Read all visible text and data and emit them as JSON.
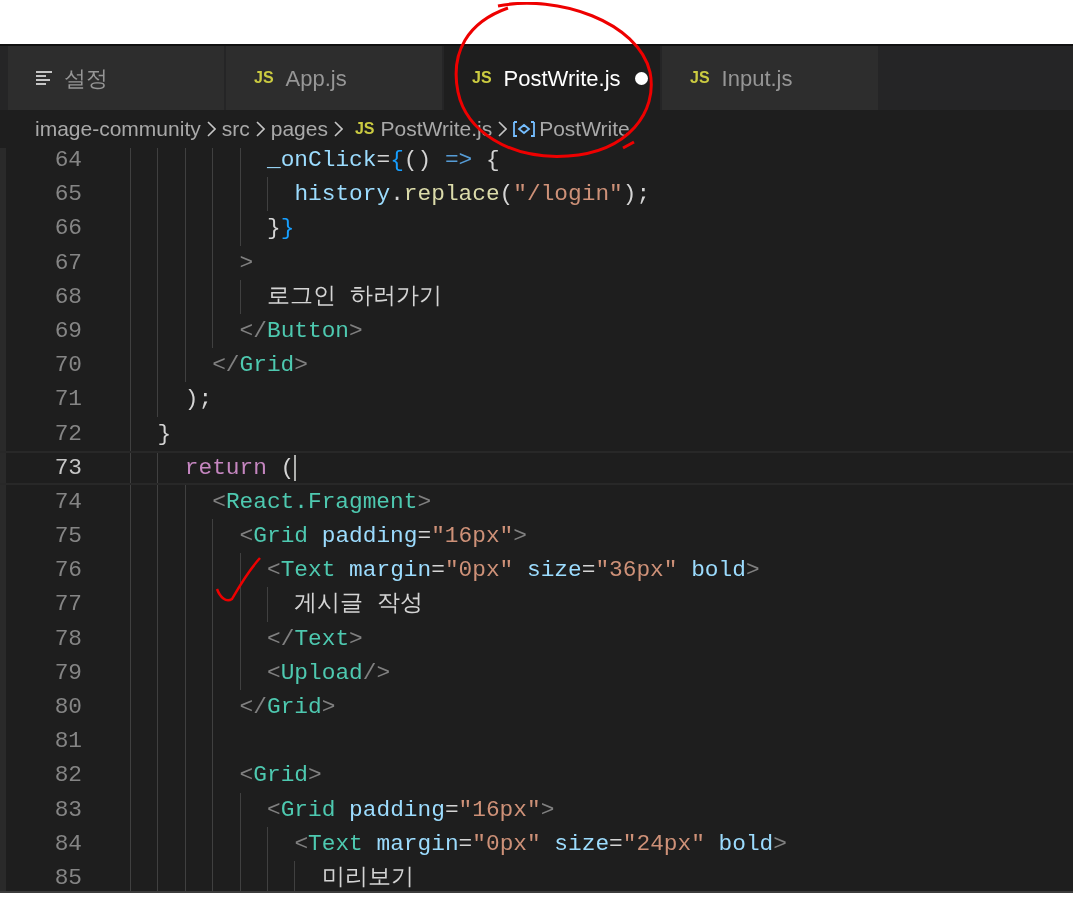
{
  "tabs": [
    {
      "kind": "settings",
      "label": "설정",
      "selected": false,
      "dirty": false
    },
    {
      "kind": "file",
      "icon_text": "JS",
      "label": "App.js",
      "selected": false,
      "dirty": false
    },
    {
      "kind": "file",
      "icon_text": "JS",
      "label": "PostWrite.js",
      "selected": true,
      "dirty": true
    },
    {
      "kind": "file",
      "icon_text": "JS",
      "label": "Input.js",
      "selected": false,
      "dirty": false
    }
  ],
  "breadcrumb": [
    {
      "kind": "folder",
      "label": "image-community"
    },
    {
      "kind": "folder",
      "label": "src"
    },
    {
      "kind": "folder",
      "label": "pages"
    },
    {
      "kind": "file",
      "icon_text": "JS",
      "label": "PostWrite.js"
    },
    {
      "kind": "symbol",
      "label": "PostWrite"
    }
  ],
  "lines": [
    {
      "number": "64",
      "current": false,
      "tokens": [
        {
          "text": "          _onClick",
          "kind": "attr"
        },
        {
          "text": "=",
          "kind": "plain"
        },
        {
          "text": "{",
          "kind": "bracket"
        },
        {
          "text": "() ",
          "kind": "plain"
        },
        {
          "text": "=>",
          "kind": "keyword"
        },
        {
          "text": " {",
          "kind": "plain"
        }
      ]
    },
    {
      "number": "65",
      "current": false,
      "tokens": [
        {
          "text": "            history",
          "kind": "var"
        },
        {
          "text": ".",
          "kind": "plain"
        },
        {
          "text": "replace",
          "kind": "fn"
        },
        {
          "text": "(",
          "kind": "plain"
        },
        {
          "text": "\"/login\"",
          "kind": "string"
        },
        {
          "text": ");",
          "kind": "plain"
        }
      ]
    },
    {
      "number": "66",
      "current": false,
      "tokens": [
        {
          "text": "          }",
          "kind": "plain"
        },
        {
          "text": "}",
          "kind": "bracket"
        }
      ]
    },
    {
      "number": "67",
      "current": false,
      "tokens": [
        {
          "text": "        >",
          "kind": "punct"
        }
      ]
    },
    {
      "number": "68",
      "current": false,
      "tokens": [
        {
          "text": "          로그인 하러가기",
          "kind": "plain"
        }
      ]
    },
    {
      "number": "69",
      "current": false,
      "tokens": [
        {
          "text": "        </",
          "kind": "punct"
        },
        {
          "text": "Button",
          "kind": "tag"
        },
        {
          "text": ">",
          "kind": "punct"
        }
      ]
    },
    {
      "number": "70",
      "current": false,
      "tokens": [
        {
          "text": "      </",
          "kind": "punct"
        },
        {
          "text": "Grid",
          "kind": "tag"
        },
        {
          "text": ">",
          "kind": "punct"
        }
      ]
    },
    {
      "number": "71",
      "current": false,
      "tokens": [
        {
          "text": "    );",
          "kind": "plain"
        }
      ]
    },
    {
      "number": "72",
      "current": false,
      "tokens": [
        {
          "text": "  }",
          "kind": "plain"
        }
      ]
    },
    {
      "number": "73",
      "current": true,
      "tokens": [
        {
          "text": "    return",
          "kind": "control"
        },
        {
          "text": " (",
          "kind": "plain"
        }
      ]
    },
    {
      "number": "74",
      "current": false,
      "tokens": [
        {
          "text": "      <",
          "kind": "punct"
        },
        {
          "text": "React.Fragment",
          "kind": "tag"
        },
        {
          "text": ">",
          "kind": "punct"
        }
      ]
    },
    {
      "number": "75",
      "current": false,
      "tokens": [
        {
          "text": "        <",
          "kind": "punct"
        },
        {
          "text": "Grid",
          "kind": "tag"
        },
        {
          "text": " padding",
          "kind": "attr"
        },
        {
          "text": "=",
          "kind": "plain"
        },
        {
          "text": "\"16px\"",
          "kind": "string"
        },
        {
          "text": ">",
          "kind": "punct"
        }
      ]
    },
    {
      "number": "76",
      "current": false,
      "tokens": [
        {
          "text": "          <",
          "kind": "punct"
        },
        {
          "text": "Text",
          "kind": "tag"
        },
        {
          "text": " margin",
          "kind": "attr"
        },
        {
          "text": "=",
          "kind": "plain"
        },
        {
          "text": "\"0px\"",
          "kind": "string"
        },
        {
          "text": " size",
          "kind": "attr"
        },
        {
          "text": "=",
          "kind": "plain"
        },
        {
          "text": "\"36px\"",
          "kind": "string"
        },
        {
          "text": " bold",
          "kind": "attr"
        },
        {
          "text": ">",
          "kind": "punct"
        }
      ]
    },
    {
      "number": "77",
      "current": false,
      "tokens": [
        {
          "text": "            게시글 작성",
          "kind": "plain"
        }
      ]
    },
    {
      "number": "78",
      "current": false,
      "tokens": [
        {
          "text": "          </",
          "kind": "punct"
        },
        {
          "text": "Text",
          "kind": "tag"
        },
        {
          "text": ">",
          "kind": "punct"
        }
      ]
    },
    {
      "number": "79",
      "current": false,
      "tokens": [
        {
          "text": "          <",
          "kind": "punct"
        },
        {
          "text": "Upload",
          "kind": "tag"
        },
        {
          "text": "/>",
          "kind": "punct"
        }
      ]
    },
    {
      "number": "80",
      "current": false,
      "tokens": [
        {
          "text": "        </",
          "kind": "punct"
        },
        {
          "text": "Grid",
          "kind": "tag"
        },
        {
          "text": ">",
          "kind": "punct"
        }
      ]
    },
    {
      "number": "81",
      "current": false
    },
    {
      "number": "82",
      "current": false,
      "tokens": [
        {
          "text": "        <",
          "kind": "punct"
        },
        {
          "text": "Grid",
          "kind": "tag"
        },
        {
          "text": ">",
          "kind": "punct"
        }
      ]
    },
    {
      "number": "83",
      "current": false,
      "tokens": [
        {
          "text": "          <",
          "kind": "punct"
        },
        {
          "text": "Grid",
          "kind": "tag"
        },
        {
          "text": " padding",
          "kind": "attr"
        },
        {
          "text": "=",
          "kind": "plain"
        },
        {
          "text": "\"16px\"",
          "kind": "string"
        },
        {
          "text": ">",
          "kind": "punct"
        }
      ]
    },
    {
      "number": "84",
      "current": false,
      "tokens": [
        {
          "text": "            <",
          "kind": "punct"
        },
        {
          "text": "Text",
          "kind": "tag"
        },
        {
          "text": " margin",
          "kind": "attr"
        },
        {
          "text": "=",
          "kind": "plain"
        },
        {
          "text": "\"0px\"",
          "kind": "string"
        },
        {
          "text": " size",
          "kind": "attr"
        },
        {
          "text": "=",
          "kind": "plain"
        },
        {
          "text": "\"24px\"",
          "kind": "string"
        },
        {
          "text": " bold",
          "kind": "attr"
        },
        {
          "text": ">",
          "kind": "punct"
        }
      ]
    },
    {
      "number": "85",
      "current": false,
      "tokens": [
        {
          "text": "              미리보기",
          "kind": "plain"
        }
      ]
    }
  ]
}
